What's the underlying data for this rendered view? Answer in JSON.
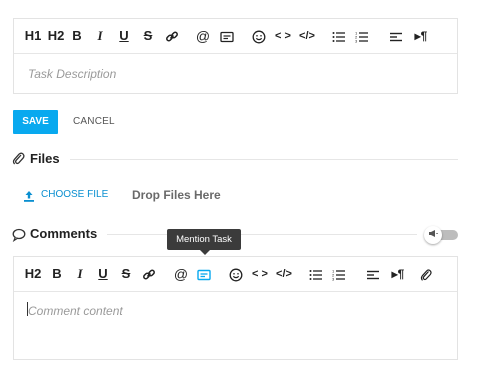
{
  "task_editor": {
    "toolbar": {
      "h1": "H1",
      "h2": "H2",
      "bold": "B",
      "italic": "I",
      "underline": "U",
      "strike": "S",
      "icons": [
        "link-icon",
        "mention-icon",
        "embed-icon",
        "emoji-icon",
        "code-inline-icon",
        "code-block-icon",
        "bullet-list-icon",
        "numbered-list-icon",
        "align-icon",
        "paragraph-direction-icon"
      ]
    },
    "placeholder": "Task Description"
  },
  "actions": {
    "save_label": "SAVE",
    "cancel_label": "CANCEL"
  },
  "files": {
    "title": "Files",
    "choose_label": "CHOOSE FILE",
    "drop_label": "Drop Files Here"
  },
  "comments": {
    "title": "Comments",
    "toggle_on": false,
    "tooltip": "Mention Task",
    "toolbar": {
      "h2": "H2",
      "bold": "B",
      "italic": "I",
      "underline": "U",
      "strike": "S"
    },
    "placeholder": "Comment content"
  },
  "colors": {
    "accent": "#08a9ef",
    "link": "#0a8fd0",
    "tooltip_bg": "#3b3b3b"
  }
}
